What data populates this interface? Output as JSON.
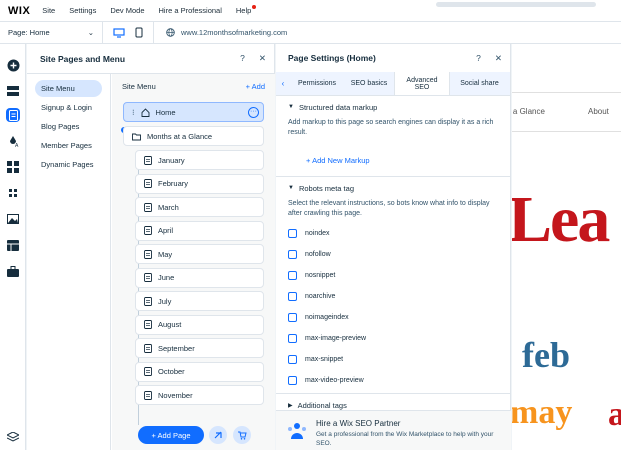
{
  "topbar": {
    "logo": "WIX",
    "menu": [
      "Site",
      "Settings",
      "Dev Mode",
      "Hire a Professional",
      "Help"
    ]
  },
  "secbar": {
    "page_select": "Page: Home",
    "url": "www.12monthsofmarketing.com"
  },
  "panel1": {
    "title": "Site Pages and Menu",
    "categories": [
      "Site Menu",
      "Signup & Login",
      "Blog Pages",
      "Member Pages",
      "Dynamic Pages"
    ],
    "menu_header": "Site Menu",
    "add_label": "+ Add",
    "home": "Home",
    "parent": "Months at a Glance",
    "months": [
      "January",
      "February",
      "March",
      "April",
      "May",
      "June",
      "July",
      "August",
      "September",
      "October",
      "November"
    ],
    "add_page": "+ Add Page"
  },
  "panel2": {
    "title": "Page Settings (Home)",
    "tabs": [
      "Permissions",
      "SEO basics",
      "Advanced SEO",
      "Social share"
    ],
    "structured": {
      "title": "Structured data markup",
      "desc": "Add markup to this page so search engines can display it as a rich result.",
      "add": "Add New Markup"
    },
    "robots": {
      "title": "Robots meta tag",
      "desc": "Select the relevant instructions, so bots know what info to display after crawling this page.",
      "options": [
        "noindex",
        "nofollow",
        "nosnippet",
        "noarchive",
        "noimageindex",
        "max-image-preview",
        "max-snippet",
        "max-video-preview"
      ]
    },
    "additional": "Additional tags",
    "partner": {
      "title": "Hire a Wix SEO Partner",
      "desc": "Get a professional from the Wix Marketplace to help with your SEO."
    }
  },
  "canvas": {
    "nav": [
      "at a Glance",
      "About"
    ],
    "words": [
      "Lea",
      "feb",
      "may",
      "a"
    ]
  },
  "colors": {
    "accent": "#116dff",
    "selected_bg": "#d6e6fe",
    "red_word": "#c4161c",
    "blue_word": "#2d6a96",
    "orange_word": "#f7941e"
  }
}
